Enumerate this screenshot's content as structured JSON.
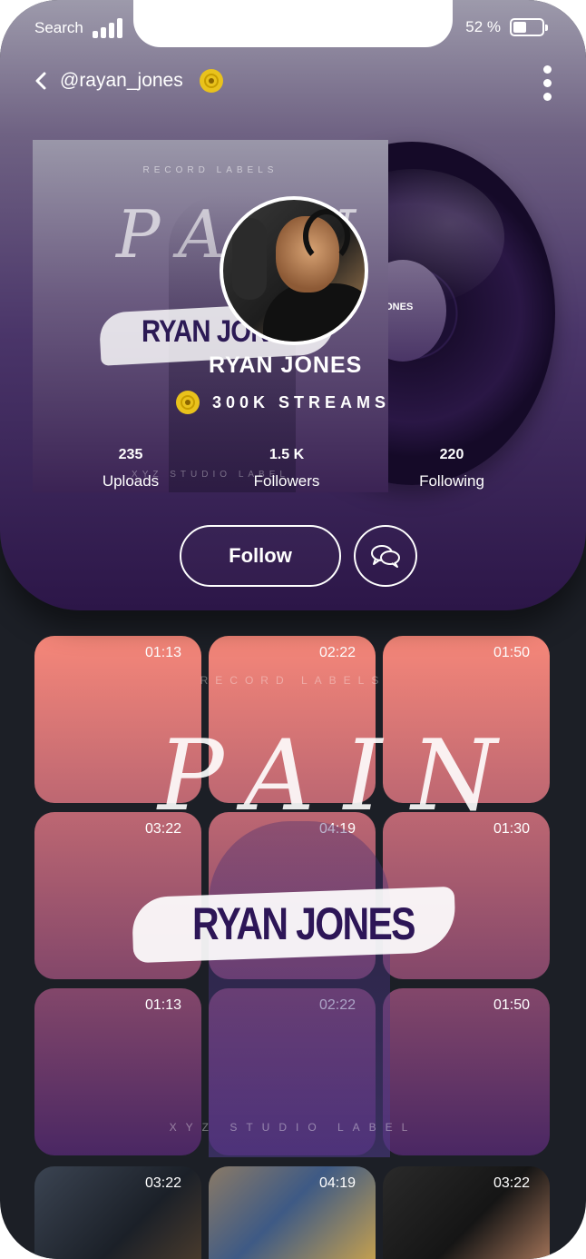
{
  "status_bar": {
    "carrier": "Search",
    "battery": "52 %",
    "battery_level": 0.52,
    "signal_bars": 4
  },
  "topbar": {
    "username": "@rayan_jones"
  },
  "album": {
    "label_top": "RECORD LABELS",
    "script_title": "PAIN",
    "artist_name": "RYAN JONES",
    "label_bottom": "XYZ STUDIO LABEL"
  },
  "vinyl": {
    "label_text": "JONES"
  },
  "profile": {
    "name": "RYAN JONES",
    "streams": "300K STREAMS"
  },
  "stats": [
    {
      "value": "235",
      "label": "Uploads"
    },
    {
      "value": "1.5 K",
      "label": "Followers"
    },
    {
      "value": "220",
      "label": "Following"
    }
  ],
  "actions": {
    "follow_label": "Follow",
    "message_icon": "chat-bubbles-icon"
  },
  "tracks": [
    {
      "duration": "01:13"
    },
    {
      "duration": "02:22"
    },
    {
      "duration": "01:50"
    },
    {
      "duration": "03:22"
    },
    {
      "duration": "04:19"
    },
    {
      "duration": "01:30"
    },
    {
      "duration": "01:13"
    },
    {
      "duration": "02:22"
    },
    {
      "duration": "01:50"
    }
  ],
  "grid_art": {
    "label_top": "RECORD LABELS",
    "script_title": "PAIN",
    "artist_name": "RYAN JONES",
    "label_bottom": "XYZ STUDIO LABEL"
  },
  "photo_tracks": [
    {
      "duration": "03:22"
    },
    {
      "duration": "04:19"
    },
    {
      "duration": "03:22"
    }
  ],
  "colors": {
    "accent": "#e9c21c",
    "tile_top": "#f68779",
    "tile_bottom": "#4a2763",
    "background": "#1c1f26"
  }
}
